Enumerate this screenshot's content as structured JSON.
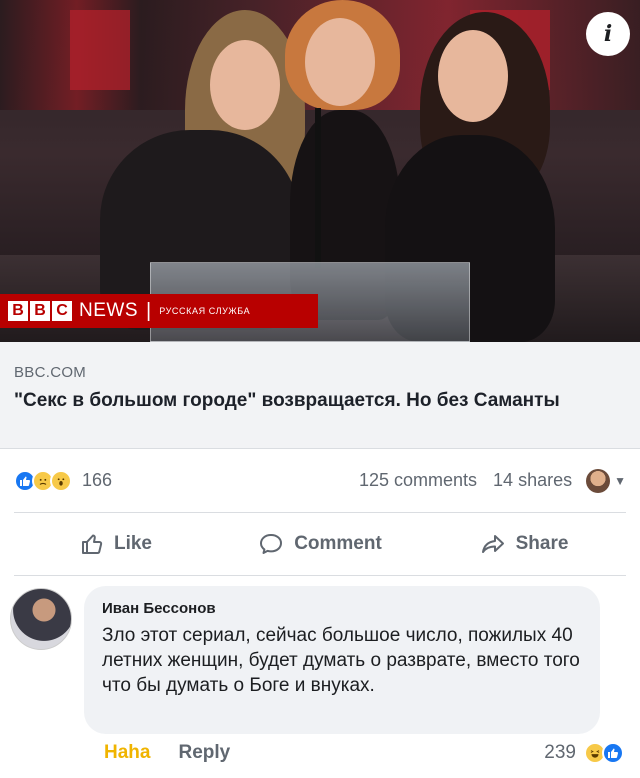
{
  "preview": {
    "info_icon": "i",
    "bbc_letters": [
      "B",
      "B",
      "C"
    ],
    "bbc_news": "NEWS",
    "bbc_separator": "|",
    "bbc_service": "РУССКАЯ СЛУЖБА"
  },
  "link": {
    "domain": "BBC.COM",
    "title": "\"Секс в большом городе\" возвращается. Но без Саманты"
  },
  "stats": {
    "reaction_icons": [
      "like-icon",
      "sad-icon",
      "wow-icon"
    ],
    "reaction_count": "166",
    "comments": "125 comments",
    "shares": "14 shares"
  },
  "actions": {
    "like": "Like",
    "comment": "Comment",
    "share": "Share"
  },
  "comment": {
    "author": "Иван Бессонов",
    "text": "Зло этот сериал, сейчас большое число, пожилых 40 летних женщин, будет думать о разврате, вместо того что бы думать о Боге и внуках.",
    "haha": "Haha",
    "reply": "Reply",
    "reaction_count": "239",
    "reaction_icons": [
      "haha-icon",
      "like-icon"
    ]
  },
  "colors": {
    "facebook_blue": "#1877f2",
    "bbc_red": "#b80000",
    "haha_yellow": "#f0b400",
    "text_gray": "#606770"
  }
}
